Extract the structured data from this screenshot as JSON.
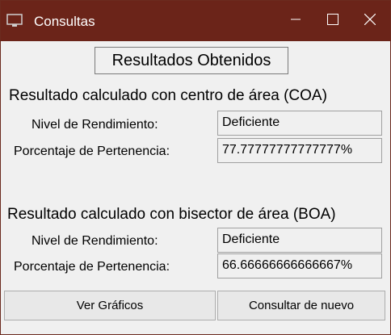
{
  "window": {
    "title": "Consultas",
    "controls": {
      "minimize_icon": "minimize-icon",
      "maximize_icon": "maximize-icon",
      "close_icon": "close-icon"
    }
  },
  "header": {
    "title": "Resultados Obtenidos"
  },
  "coa": {
    "title": "Resultado calculado con centro de área (COA)",
    "nivel_label": "Nivel de Rendimiento:",
    "nivel_value": "Deficiente",
    "porcentaje_label": "Porcentaje de Pertenencia:",
    "porcentaje_value": "77.77777777777777%"
  },
  "boa": {
    "title": "Resultado calculado con bisector de área (BOA)",
    "nivel_label": "Nivel de Rendimiento:",
    "nivel_value": "Deficiente",
    "porcentaje_label": "Porcentaje de Pertenencia:",
    "porcentaje_value": "66.66666666666667%"
  },
  "buttons": {
    "ver_graficos": "Ver Gráficos",
    "consultar_nuevo": "Consultar de nuevo"
  },
  "colors": {
    "titlebar": "#6b2419",
    "window_bg": "#f0f0f0"
  }
}
